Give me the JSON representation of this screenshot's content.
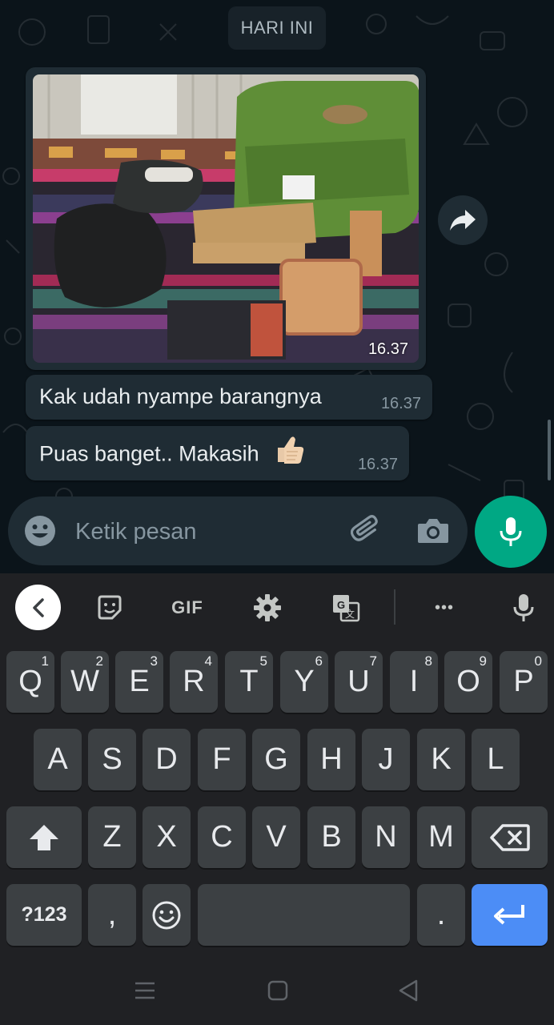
{
  "chat": {
    "date_label": "HARI INI",
    "image_message": {
      "time": "16.37"
    },
    "messages": [
      {
        "text": "Kak udah nyampe barangnya",
        "time": "16.37"
      },
      {
        "text": "Puas banget.. Makasih",
        "emoji": "👍🏻",
        "time": "16.37"
      }
    ]
  },
  "composer": {
    "placeholder": "Ketik pesan",
    "icons": [
      "emoji-icon",
      "attach-icon",
      "camera-icon",
      "mic-icon"
    ]
  },
  "keyboard": {
    "toolbar": {
      "gif_label": "GIF",
      "more_label": "•••"
    },
    "rows": [
      [
        {
          "k": "Q",
          "h": "1"
        },
        {
          "k": "W",
          "h": "2"
        },
        {
          "k": "E",
          "h": "3"
        },
        {
          "k": "R",
          "h": "4"
        },
        {
          "k": "T",
          "h": "5"
        },
        {
          "k": "Y",
          "h": "6"
        },
        {
          "k": "U",
          "h": "7"
        },
        {
          "k": "I",
          "h": "8"
        },
        {
          "k": "O",
          "h": "9"
        },
        {
          "k": "P",
          "h": "0"
        }
      ],
      [
        {
          "k": "A"
        },
        {
          "k": "S"
        },
        {
          "k": "D"
        },
        {
          "k": "F"
        },
        {
          "k": "G"
        },
        {
          "k": "H"
        },
        {
          "k": "J"
        },
        {
          "k": "K"
        },
        {
          "k": "L"
        }
      ],
      [
        {
          "k": "Z"
        },
        {
          "k": "X"
        },
        {
          "k": "C"
        },
        {
          "k": "V"
        },
        {
          "k": "B"
        },
        {
          "k": "N"
        },
        {
          "k": "M"
        }
      ]
    ],
    "symbols_label": "?123",
    "comma_label": ",",
    "period_label": "."
  },
  "colors": {
    "background": "#0b141a",
    "bubble": "#1f2c34",
    "accent": "#00a884",
    "keyboard_bg": "#202124",
    "key": "#3c4043",
    "enter_key": "#4c8df6"
  }
}
